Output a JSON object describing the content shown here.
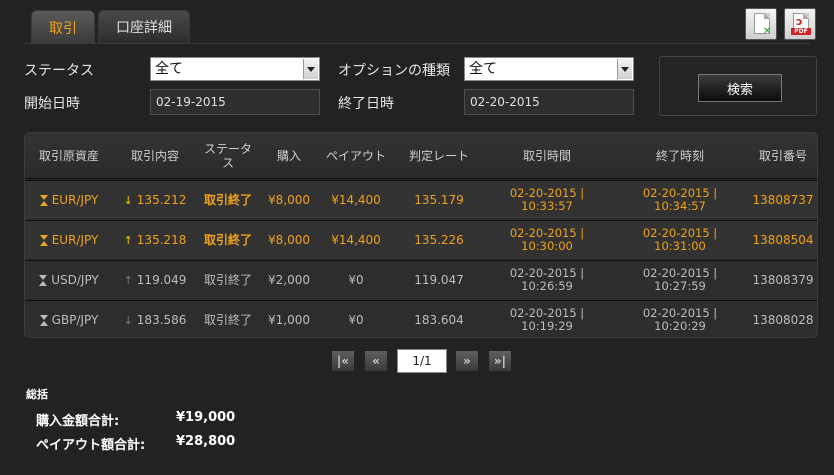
{
  "tabs": [
    {
      "label": "取引",
      "active": true
    },
    {
      "label": "口座詳細",
      "active": false
    }
  ],
  "export": {
    "excel_icon": "excel-icon",
    "pdf_icon": "pdf-icon",
    "pdf_text": "PDF"
  },
  "filters": {
    "status_label": "ステータス",
    "status_value": "全て",
    "option_label": "オプションの種類",
    "option_value": "全て",
    "start_label": "開始日時",
    "start_value": "02-19-2015",
    "end_label": "終了日時",
    "end_value": "02-20-2015",
    "search_button": "検索"
  },
  "table": {
    "headers": [
      "取引原資産",
      "取引内容",
      "ステータス",
      "購入",
      "ペイアウト",
      "判定レート",
      "取引時間",
      "終了時刻",
      "取引番号"
    ],
    "rows": [
      {
        "asset": "EUR/JPY",
        "direction": "down",
        "direction_icon": "↓",
        "rate": "135.212",
        "status": "取引終了",
        "purchase": "¥8,000",
        "payout": "¥14,400",
        "judge_rate": "135.179",
        "trade_time_1": "02-20-2015 |",
        "trade_time_2": "10:33:57",
        "end_time_1": "02-20-2015 |",
        "end_time_2": "10:34:57",
        "trade_no": "13808737",
        "highlight": true
      },
      {
        "asset": "EUR/JPY",
        "direction": "up",
        "direction_icon": "↑",
        "rate": "135.218",
        "status": "取引終了",
        "purchase": "¥8,000",
        "payout": "¥14,400",
        "judge_rate": "135.226",
        "trade_time_1": "02-20-2015 |",
        "trade_time_2": "10:30:00",
        "end_time_1": "02-20-2015 |",
        "end_time_2": "10:31:00",
        "trade_no": "13808504",
        "highlight": true
      },
      {
        "asset": "USD/JPY",
        "direction": "up",
        "direction_icon": "↑",
        "rate": "119.049",
        "status": "取引終了",
        "purchase": "¥2,000",
        "payout": "¥0",
        "judge_rate": "119.047",
        "trade_time_1": "02-20-2015 |",
        "trade_time_2": "10:26:59",
        "end_time_1": "02-20-2015 |",
        "end_time_2": "10:27:59",
        "trade_no": "13808379",
        "highlight": false
      },
      {
        "asset": "GBP/JPY",
        "direction": "down",
        "direction_icon": "↓",
        "rate": "183.586",
        "status": "取引終了",
        "purchase": "¥1,000",
        "payout": "¥0",
        "judge_rate": "183.604",
        "trade_time_1": "02-20-2015 |",
        "trade_time_2": "10:19:29",
        "end_time_1": "02-20-2015 |",
        "end_time_2": "10:20:29",
        "trade_no": "13808028",
        "highlight": false
      }
    ]
  },
  "pagination": {
    "first": "|«",
    "prev": "«",
    "page": "1/1",
    "next": "»",
    "last": "»|"
  },
  "summary": {
    "title": "総括",
    "purchase_label": "購入金額合計:",
    "purchase_value": "¥19,000",
    "payout_label": "ペイアウト額合計:",
    "payout_value": "¥28,800"
  },
  "colors": {
    "accent": "#f0a21c",
    "background": "#222222"
  }
}
